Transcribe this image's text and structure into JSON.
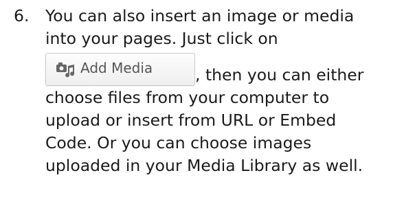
{
  "step": {
    "number": "6.",
    "line1": "You can also insert an image or media",
    "line2": "into your pages. Just click on",
    "add_media_button_label": "Add Media",
    "line3_after_button": ", then you can either",
    "line4": "choose files from your computer to",
    "line5": "upload or insert from URL or Embed",
    "line6": "Code. Or you can choose images",
    "line7": "uploaded in your Media Library as well."
  },
  "icons": {
    "add_media": "media-icon"
  },
  "colors": {
    "text": "#1a1a1a",
    "button_border": "#c8c8c8",
    "button_text": "#555555",
    "icon": "#666666"
  }
}
